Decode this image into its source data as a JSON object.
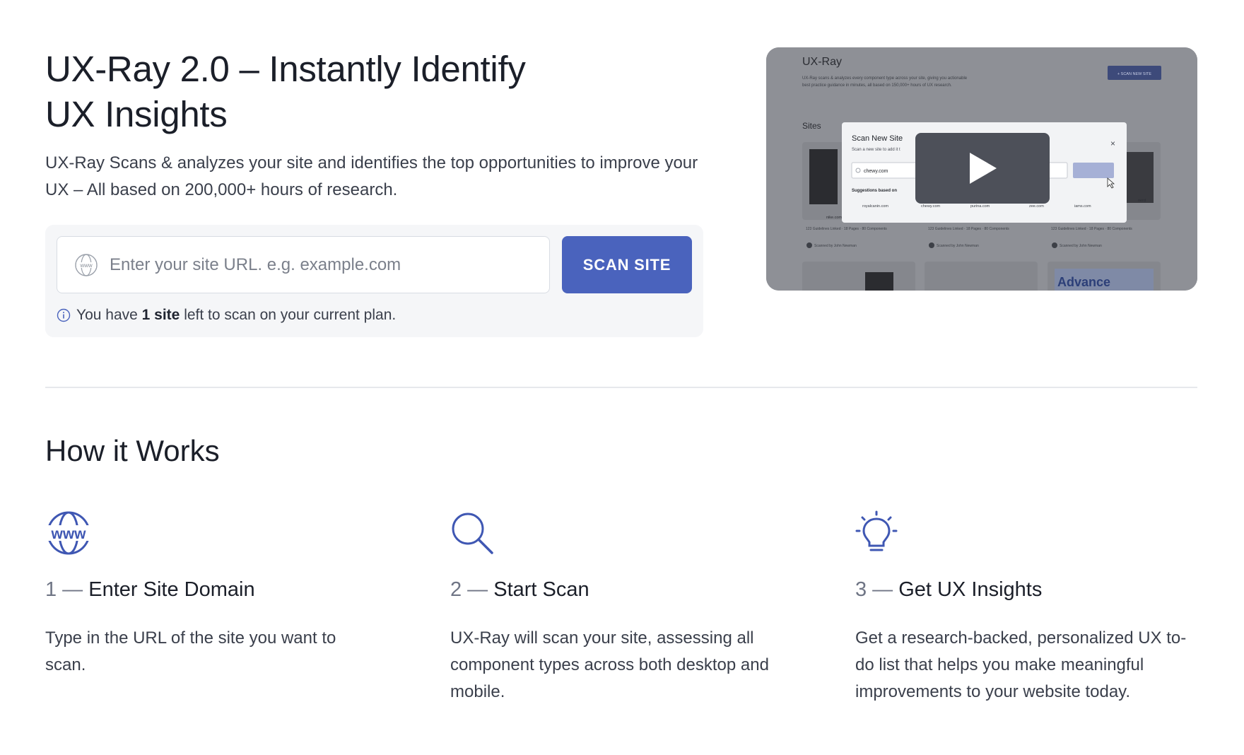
{
  "hero": {
    "title": "UX-Ray 2.0 – Instantly Identify UX Insights",
    "subtitle": "UX-Ray Scans & analyzes your site and identifies the top opportunities to improve your UX – All based on 200,000+ hours of research."
  },
  "scan": {
    "placeholder": "Enter your site URL. e.g. example.com",
    "button_label": "SCAN SITE",
    "note_prefix": "You have ",
    "note_bold": "1 site",
    "note_suffix": " left to scan on your current plan."
  },
  "video": {
    "app_title": "UX-Ray",
    "app_desc_line1": "UX-Ray scans & analyzes every component type across your site, giving you actionable",
    "app_desc_line2": "best practice guidance in minutes, all based on 150,000+ hours of UX research.",
    "scan_new_site_btn": "+ SCAN NEW SITE",
    "sites_label": "Sites",
    "modal_title": "Scan New Site",
    "modal_sub": "Scan a new site to add it t",
    "modal_input": "chewy.com",
    "suggestions_label": "Suggestions based on",
    "suggestions": [
      "royalcanin.com",
      "chewy.com",
      "purina.com",
      "zee.com",
      "iams.com"
    ],
    "card_meta": "123 Guidelines Linked · 18 Pages · 80 Components",
    "card_owner": "Scanned by John Newman",
    "card_sites": [
      "nike.com",
      "",
      "",
      "",
      "nerd"
    ],
    "advance_text": "Advance"
  },
  "how_it_works": {
    "title": "How it Works",
    "steps": [
      {
        "icon": "www-globe-icon",
        "num": "1 — ",
        "title": "Enter Site Domain",
        "desc": "Type in the URL of the site you want to scan."
      },
      {
        "icon": "magnifier-icon",
        "num": "2 — ",
        "title": "Start Scan",
        "desc": "UX-Ray will scan your site, assessing all component types across both desktop and mobile."
      },
      {
        "icon": "lightbulb-icon",
        "num": "3 — ",
        "title": "Get UX Insights",
        "desc": "Get a research-backed, personalized UX to-do list that helps you make meaningful improvements to your website today."
      }
    ]
  },
  "colors": {
    "accent": "#4a63bd",
    "icon_blue": "#3f57b3",
    "text_dark": "#1b1f29",
    "text_muted": "#3a3f4b"
  }
}
